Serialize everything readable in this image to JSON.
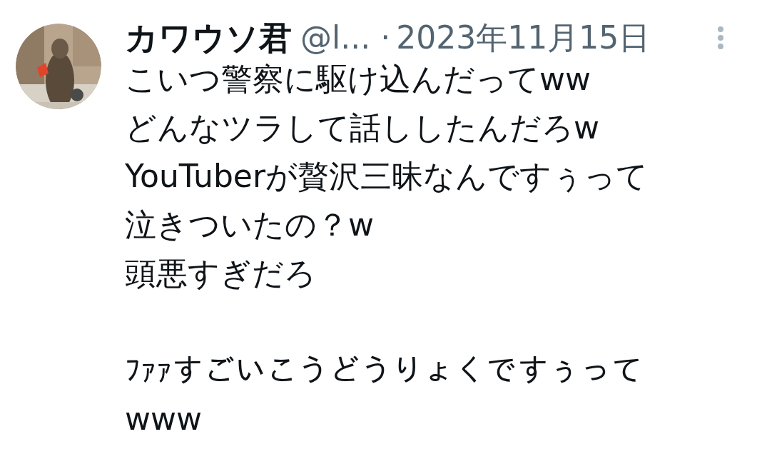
{
  "post": {
    "author_name": "カワウソ君",
    "handle": "@l...",
    "separator": "·",
    "date": "2023年11月15日",
    "paragraphs": [
      {
        "lines": [
          "こいつ警察に駆け込んだってww",
          "どんなツラして話ししたんだろw",
          "YouTuberが贅沢三昧なんですぅって",
          "泣きついたの？w",
          "頭悪すぎだろ"
        ]
      },
      {
        "lines": [
          "ﾌｧｧすごいこうどうりょくですぅって",
          "www"
        ]
      }
    ]
  }
}
